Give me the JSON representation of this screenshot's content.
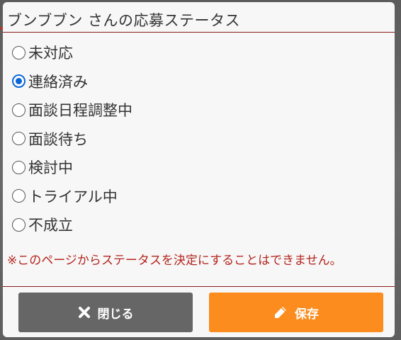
{
  "modal": {
    "title": "ブンブブン さんの応募ステータス",
    "status_options": [
      {
        "label": "未対応",
        "checked": false
      },
      {
        "label": "連絡済み",
        "checked": true
      },
      {
        "label": "面談日程調整中",
        "checked": false
      },
      {
        "label": "面談待ち",
        "checked": false
      },
      {
        "label": "検討中",
        "checked": false
      },
      {
        "label": "トライアル中",
        "checked": false
      },
      {
        "label": "不成立",
        "checked": false
      }
    ],
    "notice": "※このページからステータスを決定にすることはできません。",
    "buttons": {
      "close_label": "閉じる",
      "close_icon": "close-x-icon",
      "save_label": "保存",
      "save_icon": "pencil-icon"
    }
  },
  "colors": {
    "accent_red": "#b3261e",
    "divider": "#8b1a1a",
    "close_button": "#666666",
    "save_button": "#fb8c1d",
    "radio_checked": "#0a66d8"
  }
}
